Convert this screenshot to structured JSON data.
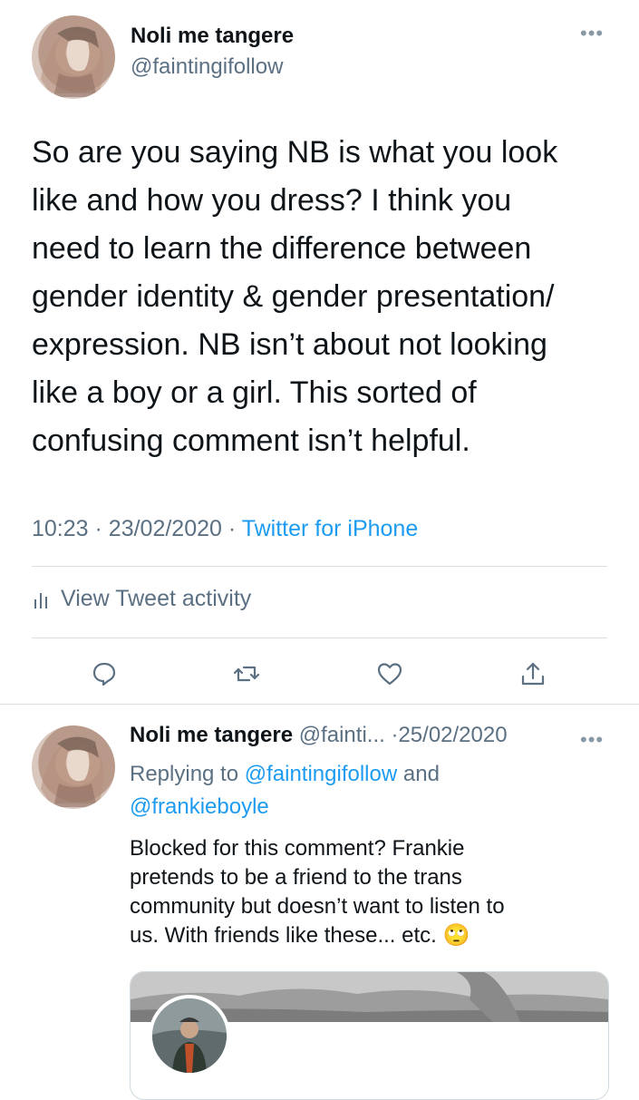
{
  "main_tweet": {
    "author_name": "Noli me tangere",
    "author_handle": "@faintingifollow",
    "more_icon": "more-horizontal-icon",
    "lines": [
      "So are you saying NB is what you look",
      "like and how you dress? I think you",
      "need to learn the difference between",
      "gender identity & gender presentation/",
      "expression. NB isn’t about not looking",
      "like a boy or a girl. This sorted of",
      "confusing comment isn’t helpful."
    ],
    "time": "10:23",
    "separator": "·",
    "date": "23/02/2020",
    "source": "Twitter for iPhone",
    "activity_label": "View Tweet activity",
    "actions": [
      "reply-icon",
      "retweet-icon",
      "like-icon",
      "share-icon"
    ]
  },
  "reply_tweet": {
    "author_name": "Noli me tangere",
    "author_handle_trunc": "@fainti...",
    "separator": "·",
    "date": "25/02/2020",
    "replying_prefix": "Replying to",
    "replying_user1": "@faintingifollow",
    "replying_and": "and",
    "replying_user2": "@frankieboyle",
    "lines": [
      "Blocked for this comment? Frankie",
      "pretends to be a friend to the trans",
      "community but doesn’t want to listen to",
      "us. With friends like these... etc."
    ],
    "emoji": "🙄"
  }
}
